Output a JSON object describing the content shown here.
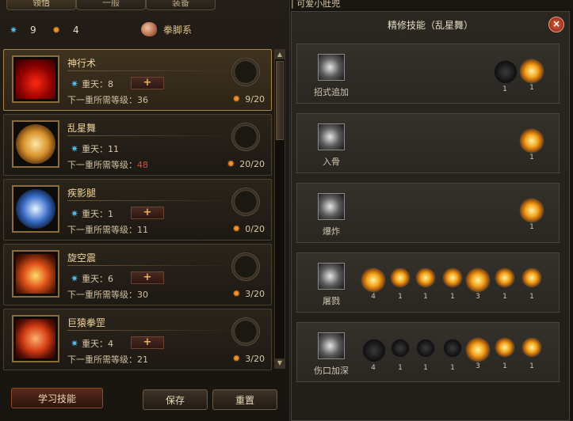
{
  "tabs": [
    {
      "label": "领悟",
      "active": true
    },
    {
      "label": "一般",
      "active": false
    },
    {
      "label": "装备",
      "active": false
    }
  ],
  "points": {
    "star": "9",
    "orb": "4",
    "style": "拳脚系"
  },
  "skills": [
    {
      "name": "神行术",
      "level": "重天：8",
      "req_label": "下一重所需等级：",
      "req_value": "36",
      "req_red": false,
      "cost": "9/20",
      "selected": true,
      "has_plus": true
    },
    {
      "name": "乱星舞",
      "level": "重天：11",
      "req_label": "下一重所需等级：",
      "req_value": "48",
      "req_red": true,
      "cost": "20/20",
      "selected": false,
      "has_plus": false
    },
    {
      "name": "疾影腿",
      "level": "重天：1",
      "req_label": "下一重所需等级：",
      "req_value": "11",
      "req_red": false,
      "cost": "0/20",
      "selected": false,
      "has_plus": true
    },
    {
      "name": "旋空震",
      "level": "重天：6",
      "req_label": "下一重所需等级：",
      "req_value": "30",
      "req_red": false,
      "cost": "3/20",
      "selected": false,
      "has_plus": true
    },
    {
      "name": "巨猿拳罡",
      "level": "重天：4",
      "req_label": "下一重所需等级：",
      "req_value": "21",
      "req_red": false,
      "cost": "3/20",
      "selected": false,
      "has_plus": true
    }
  ],
  "buttons": {
    "learn": "学习技能",
    "save": "保存",
    "reset": "重置",
    "plus": "+",
    "close": "×"
  },
  "right_topbar": "| 可爱小肚兜",
  "refine": {
    "title": "精修技能（乱星舞）",
    "rows": [
      {
        "name": "招式追加",
        "nodes": [
          {
            "count": "1",
            "gold": false,
            "big": true
          },
          {
            "count": "1",
            "gold": true,
            "big": true
          }
        ]
      },
      {
        "name": "入骨",
        "nodes": [
          {
            "count": "1",
            "gold": true,
            "big": true
          }
        ]
      },
      {
        "name": "爆炸",
        "nodes": [
          {
            "count": "1",
            "gold": true,
            "big": true
          }
        ]
      },
      {
        "name": "屠戮",
        "nodes": [
          {
            "count": "4",
            "gold": true,
            "big": true
          },
          {
            "count": "1",
            "gold": true,
            "big": false
          },
          {
            "count": "1",
            "gold": true,
            "big": false
          },
          {
            "count": "1",
            "gold": true,
            "big": false
          },
          {
            "count": "3",
            "gold": true,
            "big": true
          },
          {
            "count": "1",
            "gold": true,
            "big": false
          },
          {
            "count": "1",
            "gold": true,
            "big": false
          }
        ]
      },
      {
        "name": "伤口加深",
        "nodes": [
          {
            "count": "4",
            "gold": false,
            "big": true
          },
          {
            "count": "1",
            "gold": false,
            "big": false
          },
          {
            "count": "1",
            "gold": false,
            "big": false
          },
          {
            "count": "1",
            "gold": false,
            "big": false
          },
          {
            "count": "3",
            "gold": true,
            "big": true
          },
          {
            "count": "1",
            "gold": true,
            "big": false
          },
          {
            "count": "1",
            "gold": true,
            "big": false
          }
        ]
      }
    ]
  },
  "icons": {
    "star": "star-icon",
    "orb": "orb-icon",
    "fist": "fist-icon",
    "close": "close-icon"
  },
  "colors": {
    "accent_gold": "#f0d59c",
    "star_blue": "#57b9e8",
    "orb_orange": "#f0902a",
    "req_red": "#e24a3a"
  }
}
